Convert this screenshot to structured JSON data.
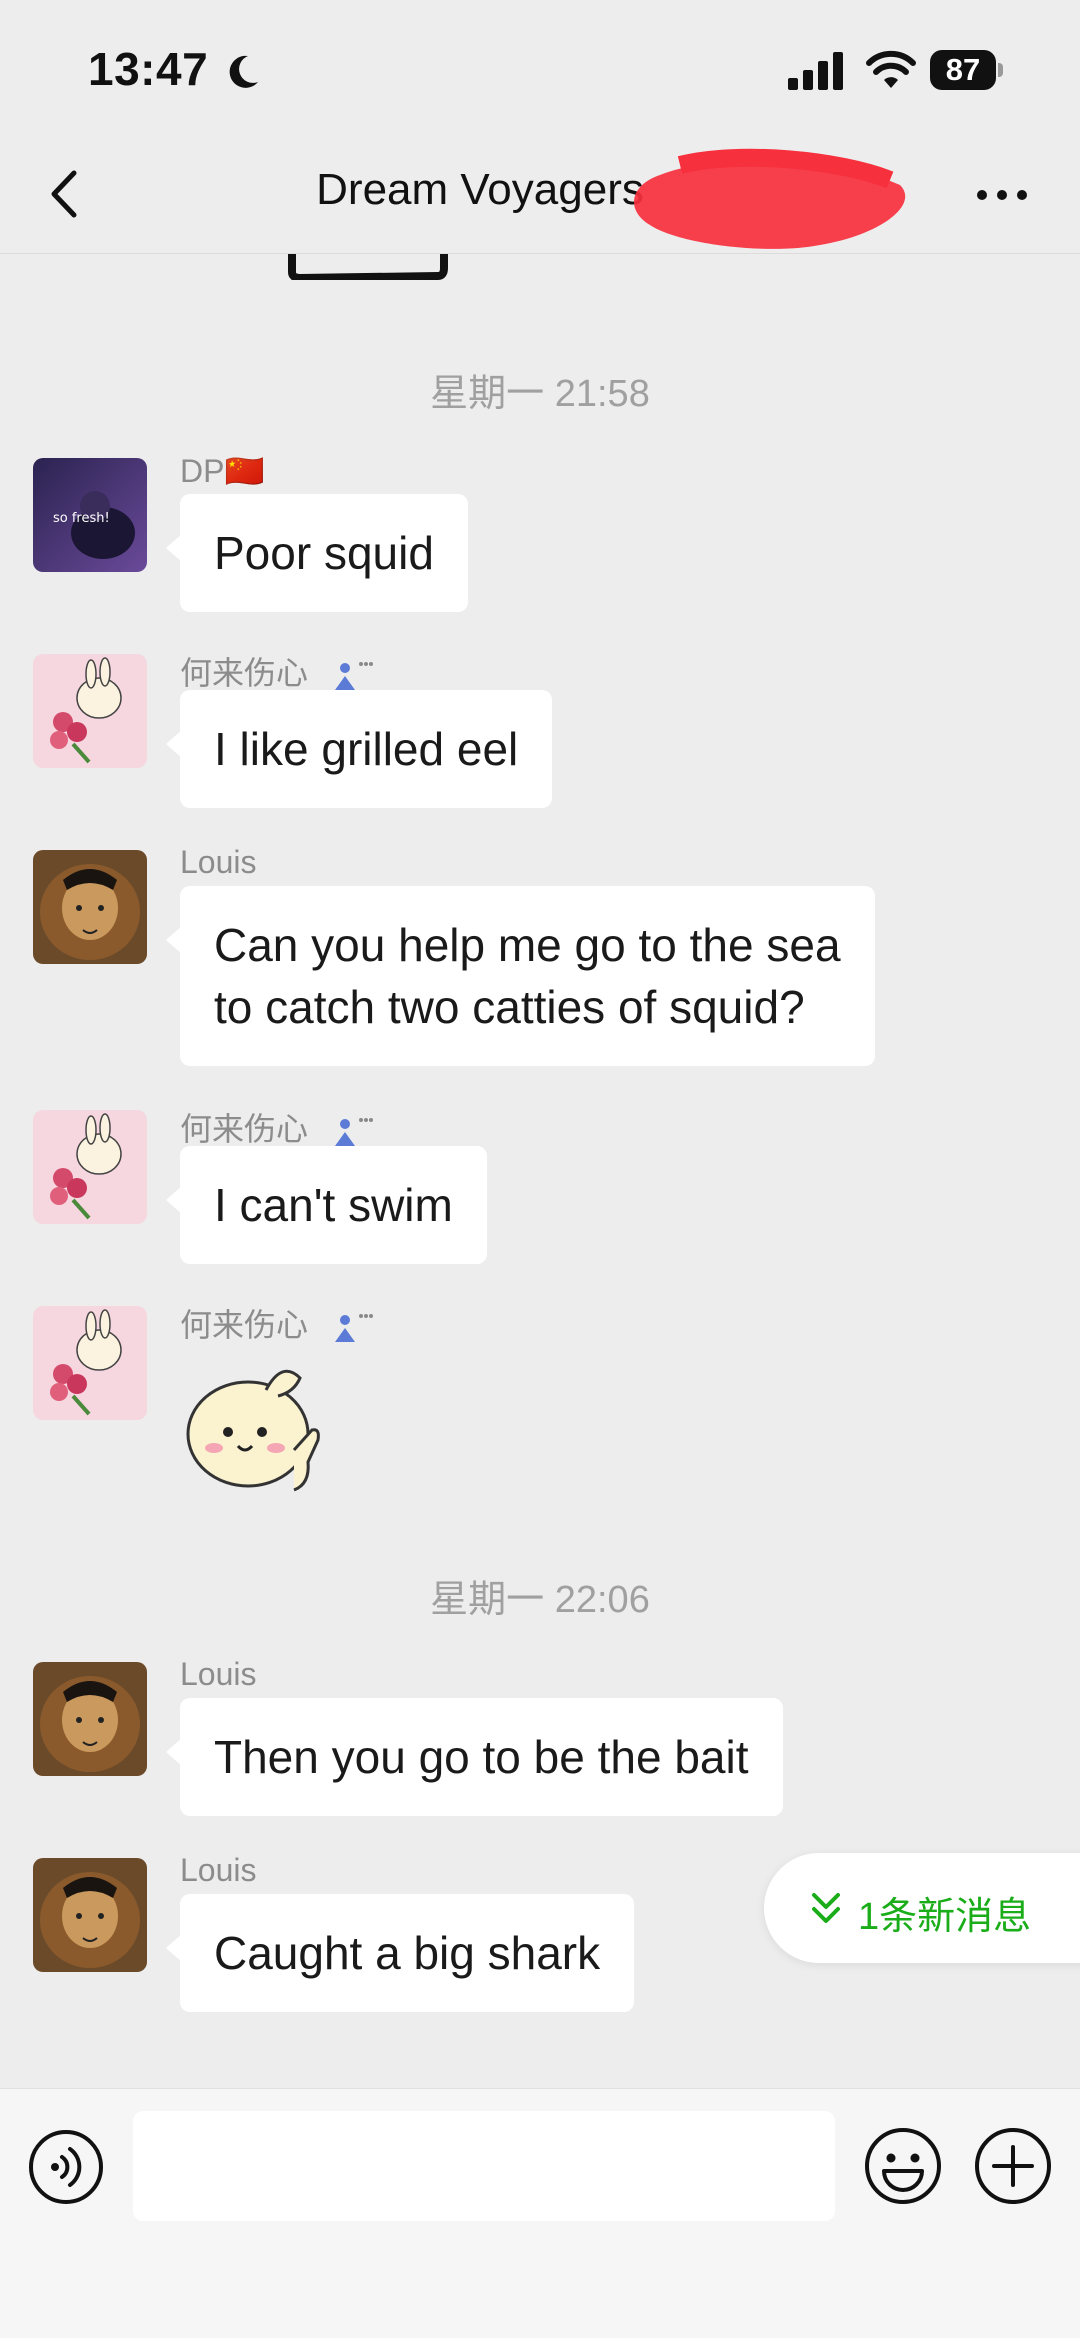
{
  "status_bar": {
    "time": "13:47",
    "battery": "87",
    "icons": [
      "moon-icon",
      "cellular-signal-icon",
      "wifi-icon",
      "battery-icon"
    ]
  },
  "nav": {
    "title": "Dream Voyagers",
    "icons": [
      "back-chevron-icon",
      "more-dots-icon"
    ]
  },
  "timestamps": [
    "星期一 21:58",
    "星期一 22:06"
  ],
  "messages": [
    {
      "sender": "DP🇨🇳",
      "text": "Poor squid",
      "avatar": "dp-avatar"
    },
    {
      "sender": "何来伤心",
      "text": "I like grilled eel",
      "avatar": "bunny-avatar"
    },
    {
      "sender": "Louis",
      "text_lines": [
        "Can you help me go to the sea",
        "to catch two catties of squid?"
      ],
      "avatar": "lion-avatar"
    },
    {
      "sender": "何来伤心",
      "text": "I can't swim",
      "avatar": "bunny-avatar"
    },
    {
      "sender": "何来伤心",
      "sticker": "bunny-sticker",
      "avatar": "bunny-avatar"
    },
    {
      "sender": "Louis",
      "text": "Then you go to be the bait",
      "avatar": "lion-avatar"
    },
    {
      "sender": "Louis",
      "text": "Caught a big shark",
      "avatar": "lion-avatar"
    }
  ],
  "new_message_pill": "1条新消息",
  "input_bar": {
    "placeholder": "",
    "icons": [
      "voice-icon",
      "emoji-icon",
      "plus-icon"
    ]
  },
  "colors": {
    "background": "#ededed",
    "bubble": "#ffffff",
    "accent_green": "#1aad19",
    "timestamp": "#a0a0a0",
    "sender": "#8c8c8c"
  }
}
